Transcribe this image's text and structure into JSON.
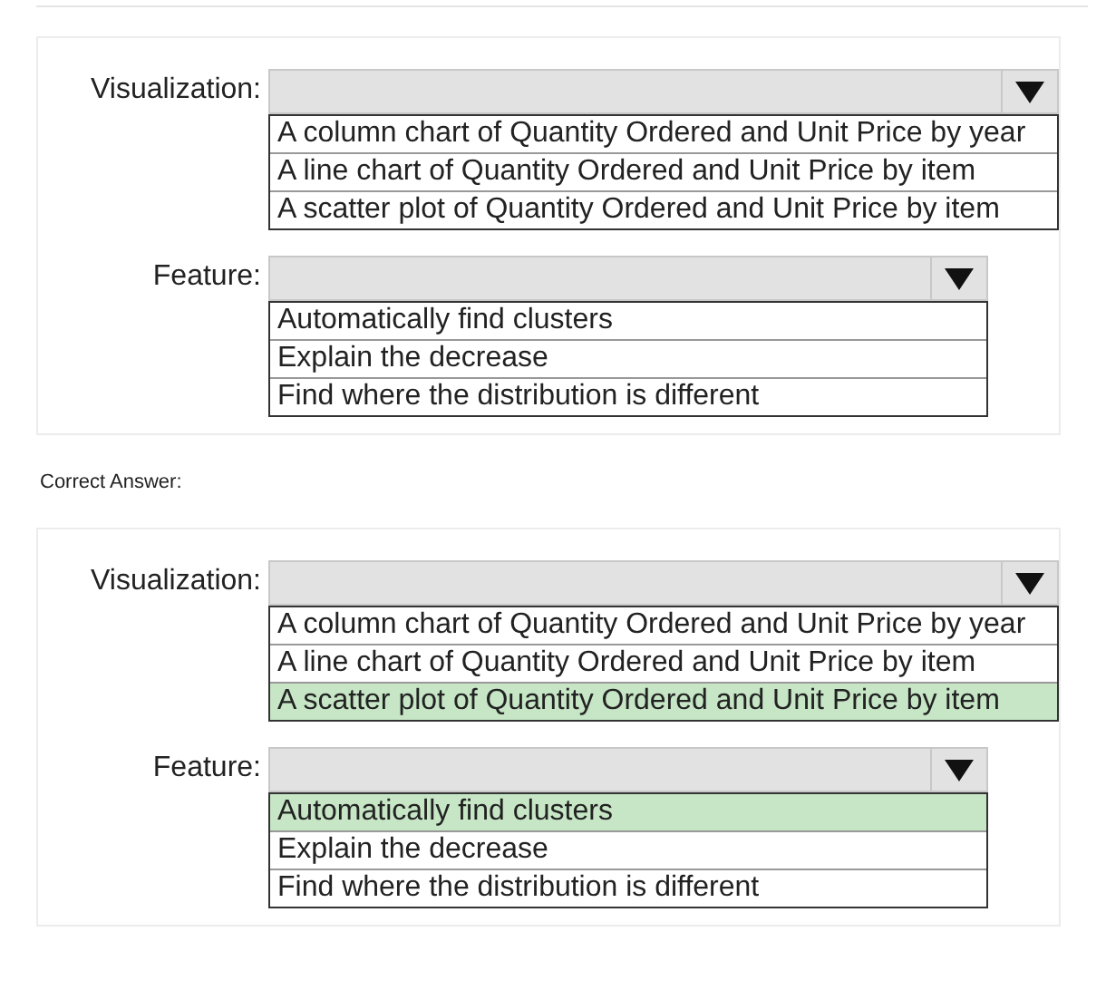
{
  "question": {
    "fields": [
      {
        "label": "Visualization:",
        "options": [
          {
            "text": "A column chart of Quantity Ordered and Unit Price by year",
            "selected": false
          },
          {
            "text": "A line chart of Quantity Ordered and Unit Price by item",
            "selected": false
          },
          {
            "text": "A scatter plot of Quantity Ordered and Unit Price by item",
            "selected": false
          }
        ]
      },
      {
        "label": "Feature:",
        "options": [
          {
            "text": "Automatically find clusters",
            "selected": false
          },
          {
            "text": "Explain the decrease",
            "selected": false
          },
          {
            "text": "Find where the distribution is different",
            "selected": false
          }
        ]
      }
    ]
  },
  "answer_heading": "Correct Answer:",
  "answer": {
    "fields": [
      {
        "label": "Visualization:",
        "options": [
          {
            "text": "A column chart of Quantity Ordered and Unit Price by year",
            "selected": false
          },
          {
            "text": "A line chart of Quantity Ordered and Unit Price by item",
            "selected": false
          },
          {
            "text": "A scatter plot of Quantity Ordered and Unit Price by item",
            "selected": true
          }
        ]
      },
      {
        "label": "Feature:",
        "options": [
          {
            "text": "Automatically find clusters",
            "selected": true
          },
          {
            "text": "Explain the decrease",
            "selected": false
          },
          {
            "text": "Find where the distribution is different",
            "selected": false
          }
        ]
      }
    ]
  }
}
